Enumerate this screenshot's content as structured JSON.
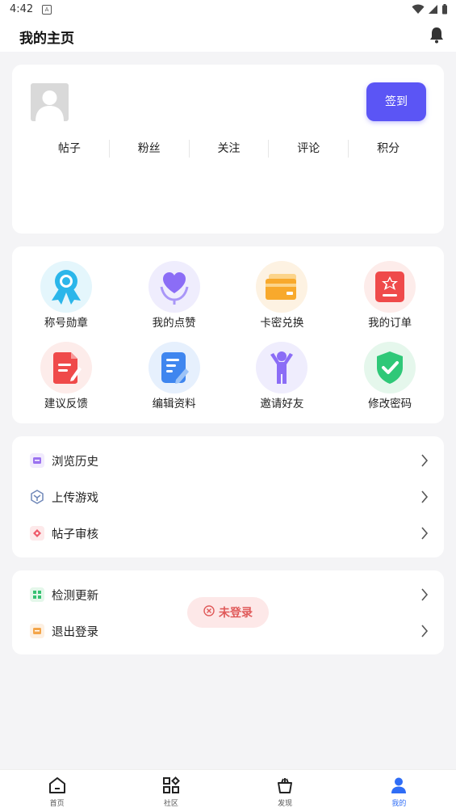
{
  "status_bar": {
    "time": "4:42",
    "notif_badge": "A"
  },
  "header": {
    "title": "我的主页"
  },
  "profile": {
    "signin_label": "签到",
    "stats": [
      "帖子",
      "粉丝",
      "关注",
      "评论",
      "积分"
    ]
  },
  "features": [
    {
      "label": "称号勋章",
      "icon": "medal-icon"
    },
    {
      "label": "我的点赞",
      "icon": "heart-hand-icon"
    },
    {
      "label": "卡密兑换",
      "icon": "card-icon"
    },
    {
      "label": "我的订单",
      "icon": "order-icon"
    },
    {
      "label": "建议反馈",
      "icon": "feedback-doc-icon"
    },
    {
      "label": "编辑资料",
      "icon": "edit-doc-icon"
    },
    {
      "label": "邀请好友",
      "icon": "person-cheer-icon"
    },
    {
      "label": "修改密码",
      "icon": "shield-check-icon"
    }
  ],
  "list1": [
    {
      "label": "浏览历史",
      "icon": "history-icon"
    },
    {
      "label": "上传游戏",
      "icon": "upload-cube-icon"
    },
    {
      "label": "帖子审核",
      "icon": "review-tag-icon"
    }
  ],
  "list2": [
    {
      "label": "检测更新",
      "icon": "update-grid-icon"
    },
    {
      "label": "退出登录",
      "icon": "logout-icon"
    }
  ],
  "toast": {
    "text": "未登录"
  },
  "tabs": [
    {
      "label": "首页",
      "icon": "home-icon"
    },
    {
      "label": "社区",
      "icon": "community-grid-icon"
    },
    {
      "label": "发现",
      "icon": "discover-bag-icon"
    },
    {
      "label": "我的",
      "icon": "profile-person-icon",
      "active": true
    }
  ],
  "colors": {
    "accent": "#5b55f5",
    "tab_active": "#2f6df6",
    "toast_text": "#e05a5a",
    "toast_bg": "#fde8e8"
  }
}
